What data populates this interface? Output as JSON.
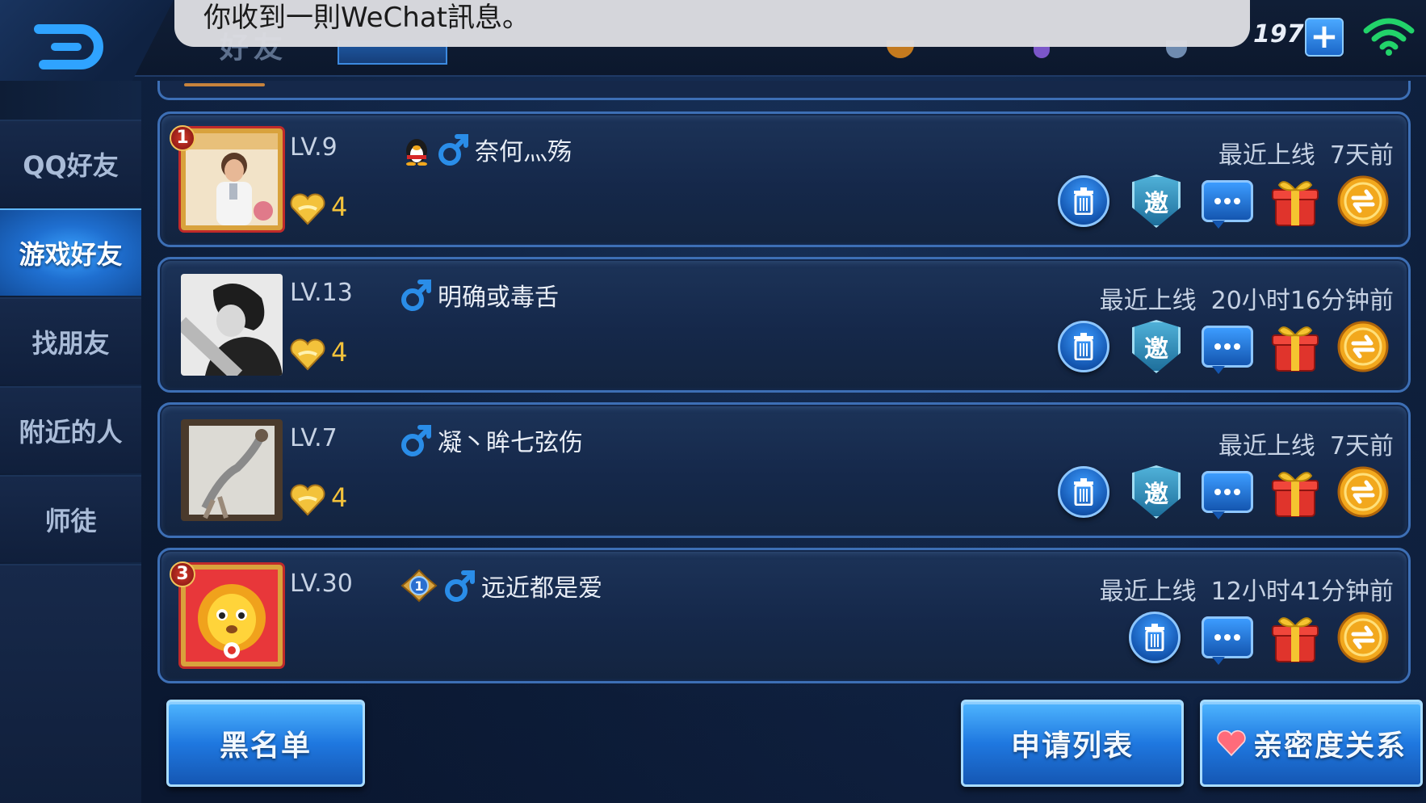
{
  "notification": {
    "text": "你收到一則WeChat訊息。"
  },
  "header": {
    "title": "好友",
    "currency_count": "197",
    "plus_label": "+"
  },
  "sidebar": {
    "items": [
      {
        "label": "QQ好友",
        "active": false
      },
      {
        "label": "游戏好友",
        "active": true
      },
      {
        "label": "找朋友",
        "active": false
      },
      {
        "label": "附近的人",
        "active": false
      },
      {
        "label": "师徒",
        "active": false
      }
    ]
  },
  "friends": [
    {
      "rank_badge": "1",
      "level": "LV.9",
      "hearts": "4",
      "name": "奈何灬殇",
      "last_online_label": "最近上线",
      "last_online_time": "7天前",
      "has_qq_icon": true,
      "invite_label": "邀"
    },
    {
      "level": "LV.13",
      "hearts": "4",
      "name": "明确或毒舌",
      "last_online_label": "最近上线",
      "last_online_time": "20小时16分钟前",
      "invite_label": "邀"
    },
    {
      "level": "LV.7",
      "hearts": "4",
      "name": "凝丶眸七弦伤",
      "last_online_label": "最近上线",
      "last_online_time": "7天前",
      "invite_label": "邀"
    },
    {
      "rank_badge": "3",
      "level": "LV.30",
      "name": "远近都是爱",
      "rank_icon_number": "1",
      "last_online_label": "最近上线",
      "last_online_time": "12小时41分钟前"
    }
  ],
  "bottom": {
    "blacklist": "黑名单",
    "request_list": "申请列表",
    "intimacy": "亲密度关系"
  },
  "colors": {
    "accent_blue": "#1f78e0",
    "heart_gold": "#f3c23b",
    "gender_blue": "#2a8de8"
  },
  "icons": [
    "back-icon",
    "wifi-icon",
    "qq-penguin-icon",
    "male-icon",
    "heart-icon",
    "trash-icon",
    "chat-icon",
    "gift-icon",
    "coin-send-icon",
    "rank-icon"
  ]
}
